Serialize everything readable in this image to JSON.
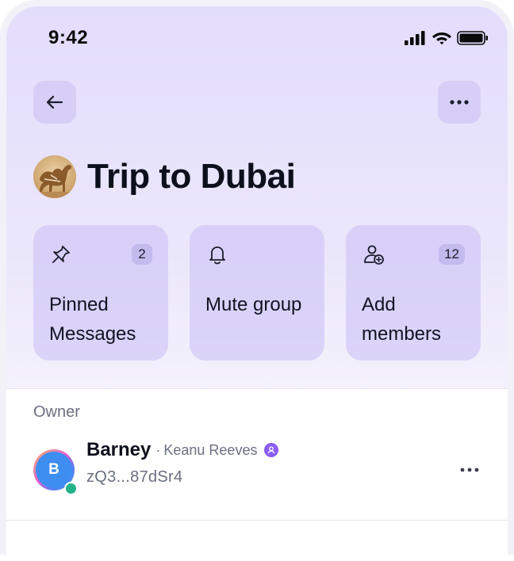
{
  "status_bar": {
    "time": "9:42"
  },
  "header": {
    "back_icon": "arrow-left-icon",
    "more_icon": "ellipsis-icon"
  },
  "group": {
    "title": "Trip to Dubai",
    "avatar": "camel-photo"
  },
  "cards": [
    {
      "label": "Pinned Messages",
      "badge": "2",
      "icon": "pin-icon"
    },
    {
      "label": "Mute group",
      "icon": "bell-icon"
    },
    {
      "label": "Add members",
      "badge": "12",
      "icon": "add-user-icon"
    }
  ],
  "members": {
    "section_label": "Owner",
    "owner": {
      "initial": "B",
      "name": "Barney",
      "separator": "·",
      "nickname": "Keanu Reeves",
      "address": "zQ3...87dSr4",
      "online": true
    }
  },
  "colors": {
    "accent": "#8a5cf5",
    "online": "#22b287",
    "background": "#e3ddfc"
  }
}
